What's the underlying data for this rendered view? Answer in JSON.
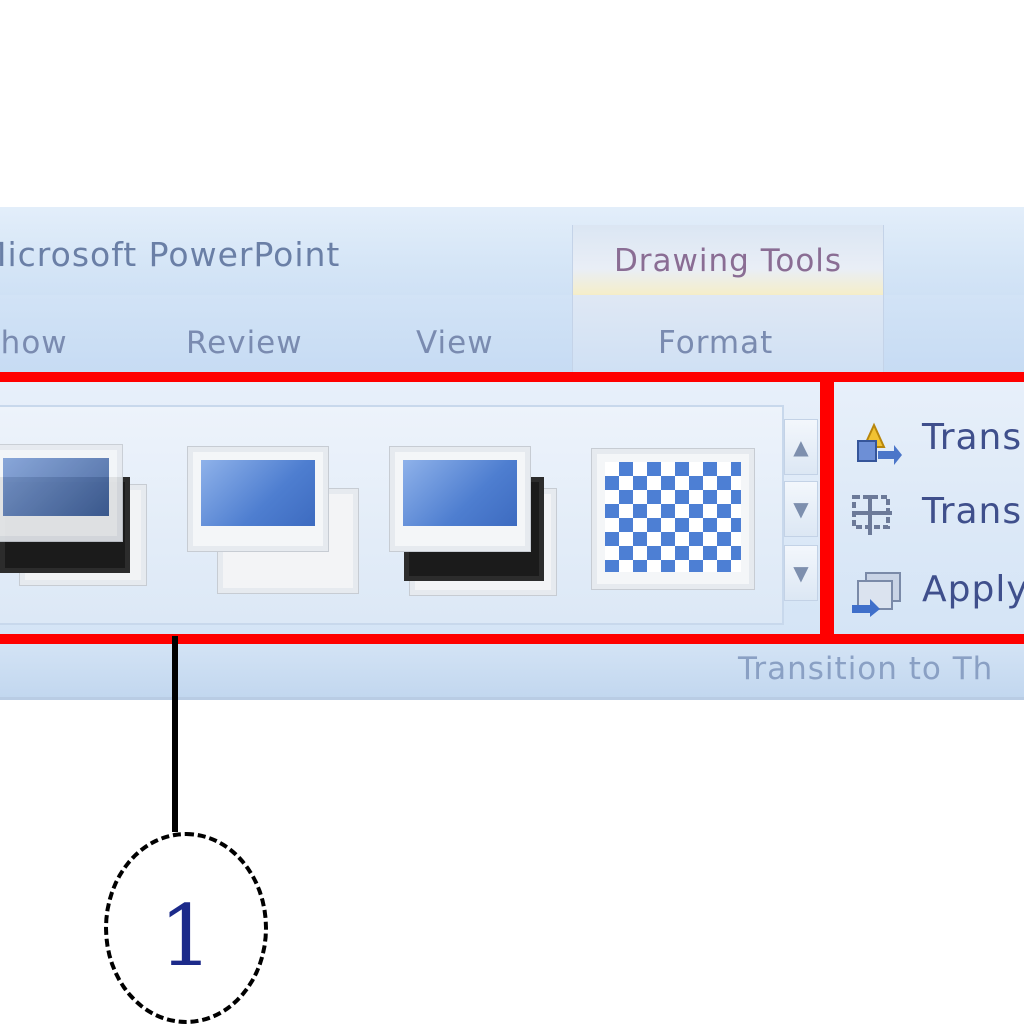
{
  "window": {
    "app_title": "Microsoft PowerPoint",
    "contextual_tab_group": "Drawing Tools"
  },
  "tabs": [
    {
      "label": "Show"
    },
    {
      "label": "Review"
    },
    {
      "label": "View"
    },
    {
      "label": "Format"
    }
  ],
  "gallery": {
    "items": [
      {
        "name": "shadow-style-1",
        "style": "dark-shadow-offset"
      },
      {
        "name": "shadow-style-2",
        "style": "light-shadow-offset"
      },
      {
        "name": "shadow-style-3",
        "style": "dark-shadow"
      },
      {
        "name": "shadow-style-4",
        "style": "checker-pattern"
      }
    ],
    "scroll_up_glyph": "▲",
    "scroll_down_glyph": "▼",
    "more_glyph": "▼"
  },
  "commands": [
    {
      "label": "Trans",
      "icon": "transition-sound-icon"
    },
    {
      "label": "Trans",
      "icon": "transition-speed-icon"
    },
    {
      "label": "Apply",
      "icon": "apply-to-all-icon"
    }
  ],
  "group_label": "Transition to Th",
  "callout": {
    "number": "1"
  },
  "colors": {
    "highlight": "#ff0000",
    "ribbon_blue": "#d4e4f6",
    "tab_text": "#7a8bb0",
    "command_text": "#3f4f8c",
    "callout_number": "#1c2a8a"
  }
}
